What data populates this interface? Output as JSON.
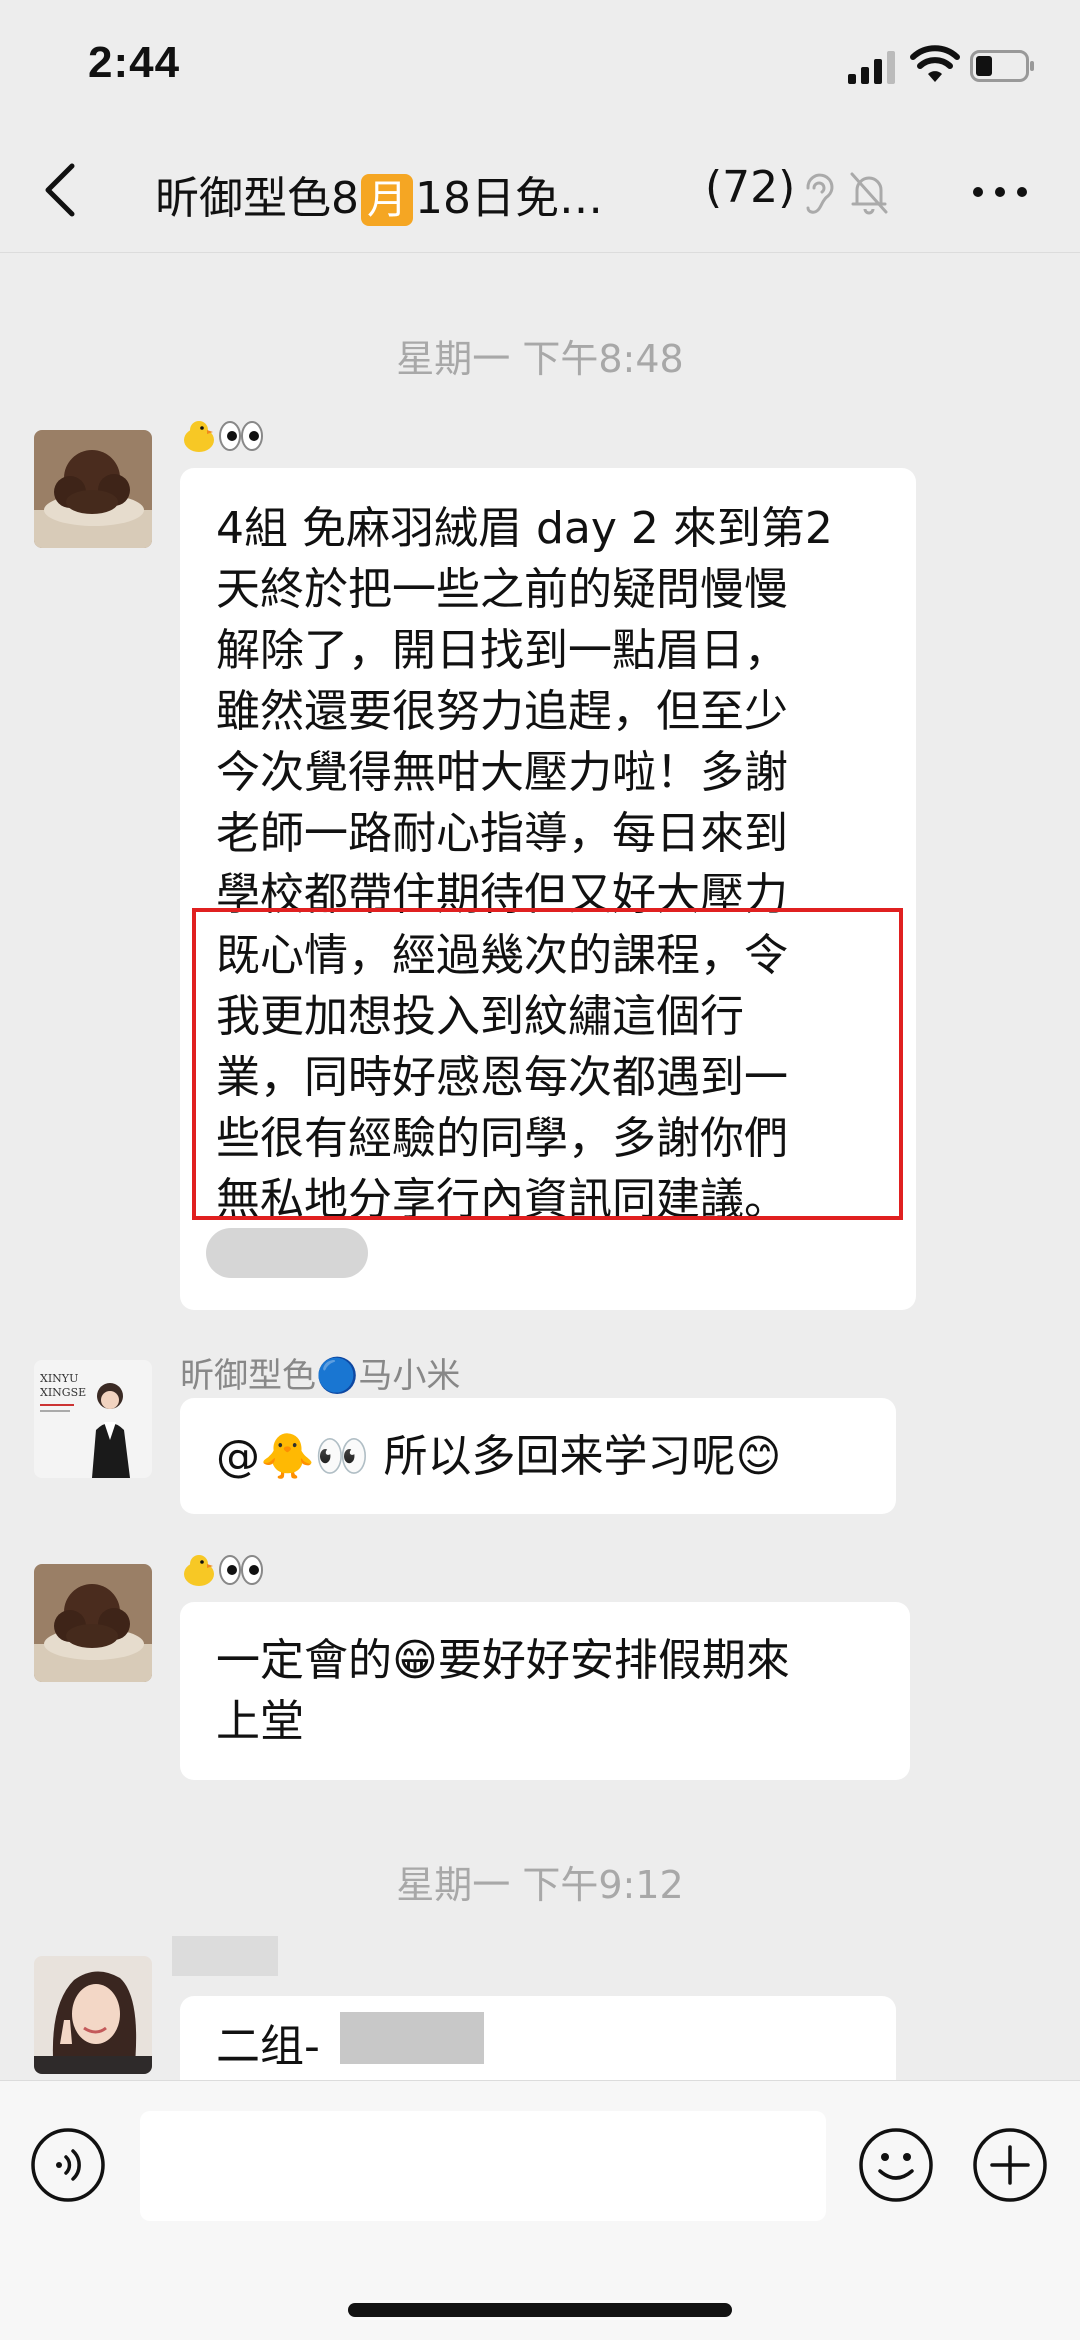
{
  "status_bar": {
    "time": "2:44"
  },
  "header": {
    "title_prefix": "昕御型色8",
    "title_badge": "月",
    "title_suffix": "18日免…",
    "member_count": "(72)"
  },
  "messages": [
    {
      "timestamp": "星期一 下午8:48"
    },
    {
      "sender": "🐥👀",
      "text_lines": [
        "4組 免麻羽絨眉 day 2 來到第2",
        "天終於把一些之前的疑問慢慢",
        "解除了，開日找到一點眉日，",
        "雖然還要很努力追趕，但至少",
        "今次覺得無咁大壓力啦！多謝",
        "老師一路耐心指導，每日來到",
        "學校都帶住期待但又好大壓力",
        "既心情，經過幾次的課程，令",
        "我更加想投入到紋繡這個行",
        "業，同時好感恩每次都遇到一",
        "些很有經驗的同學，多謝你們",
        "無私地分享行內資訊同建議。"
      ]
    },
    {
      "sender": "昕御型色🔵马小米",
      "text": "@🐥👀 所以多回来学习呢😊"
    },
    {
      "sender": "🐥👀",
      "text_lines": [
        "一定會的😁要好好安排假期來",
        "上堂"
      ]
    },
    {
      "timestamp": "星期一 下午9:12"
    },
    {
      "text": "二组-"
    }
  ],
  "avatar_labels": {
    "brand_line1": "XINYU",
    "brand_line2": "XINGSE"
  },
  "colors": {
    "background": "#ededed",
    "bubble": "#ffffff",
    "badge": "#f5a623",
    "highlight": "#e02020"
  }
}
